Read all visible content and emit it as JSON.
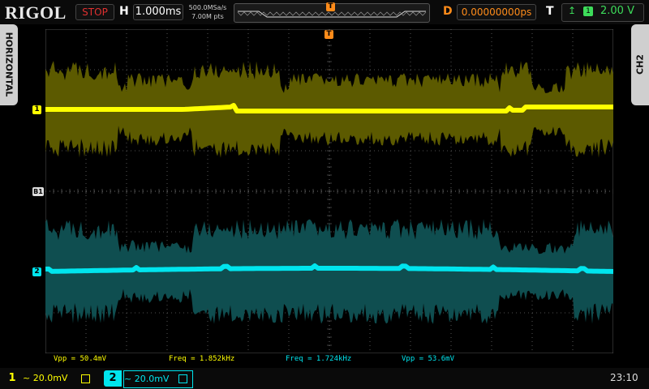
{
  "header": {
    "brand": "RIGOL",
    "run_state": "STOP",
    "horizontal_label": "H",
    "timebase": "1.000ms",
    "sample_rate": "500.0MSa/s",
    "memory_depth": "7.00M pts",
    "trigger_position_marker": "T",
    "delay_label": "D",
    "delay_value": "0.00000000ps",
    "trigger_label": "T",
    "trigger_source": "1",
    "trigger_level": "2.00 V"
  },
  "side_tabs": {
    "left": "HORIZONTAL",
    "right": "CH2"
  },
  "markers": {
    "ch1": "1",
    "ch2": "2",
    "math": "B1",
    "top_trigger": "T"
  },
  "measurements": {
    "vpp_ch1": "Vpp = 50.4mV",
    "freq_ch1": "Freq = 1.852kHz",
    "freq_ch2": "Freq = 1.724kHz",
    "vpp_ch2": "Vpp = 53.6mV"
  },
  "channels": [
    {
      "number": "1",
      "setting": "~ 20.0mV",
      "color": "#ffff00"
    },
    {
      "number": "2",
      "setting": "~ 20.0mV",
      "color": "#00e5ee"
    }
  ],
  "clock": "23:10",
  "colors": {
    "ch1": "#ffff00",
    "ch1_envelope": "#5c5a00",
    "ch2": "#00e5ee",
    "ch2_envelope": "#0f4e50",
    "grid": "#6a6a6a",
    "trigger": "#ff8c1a",
    "stop": "#e03030"
  }
}
